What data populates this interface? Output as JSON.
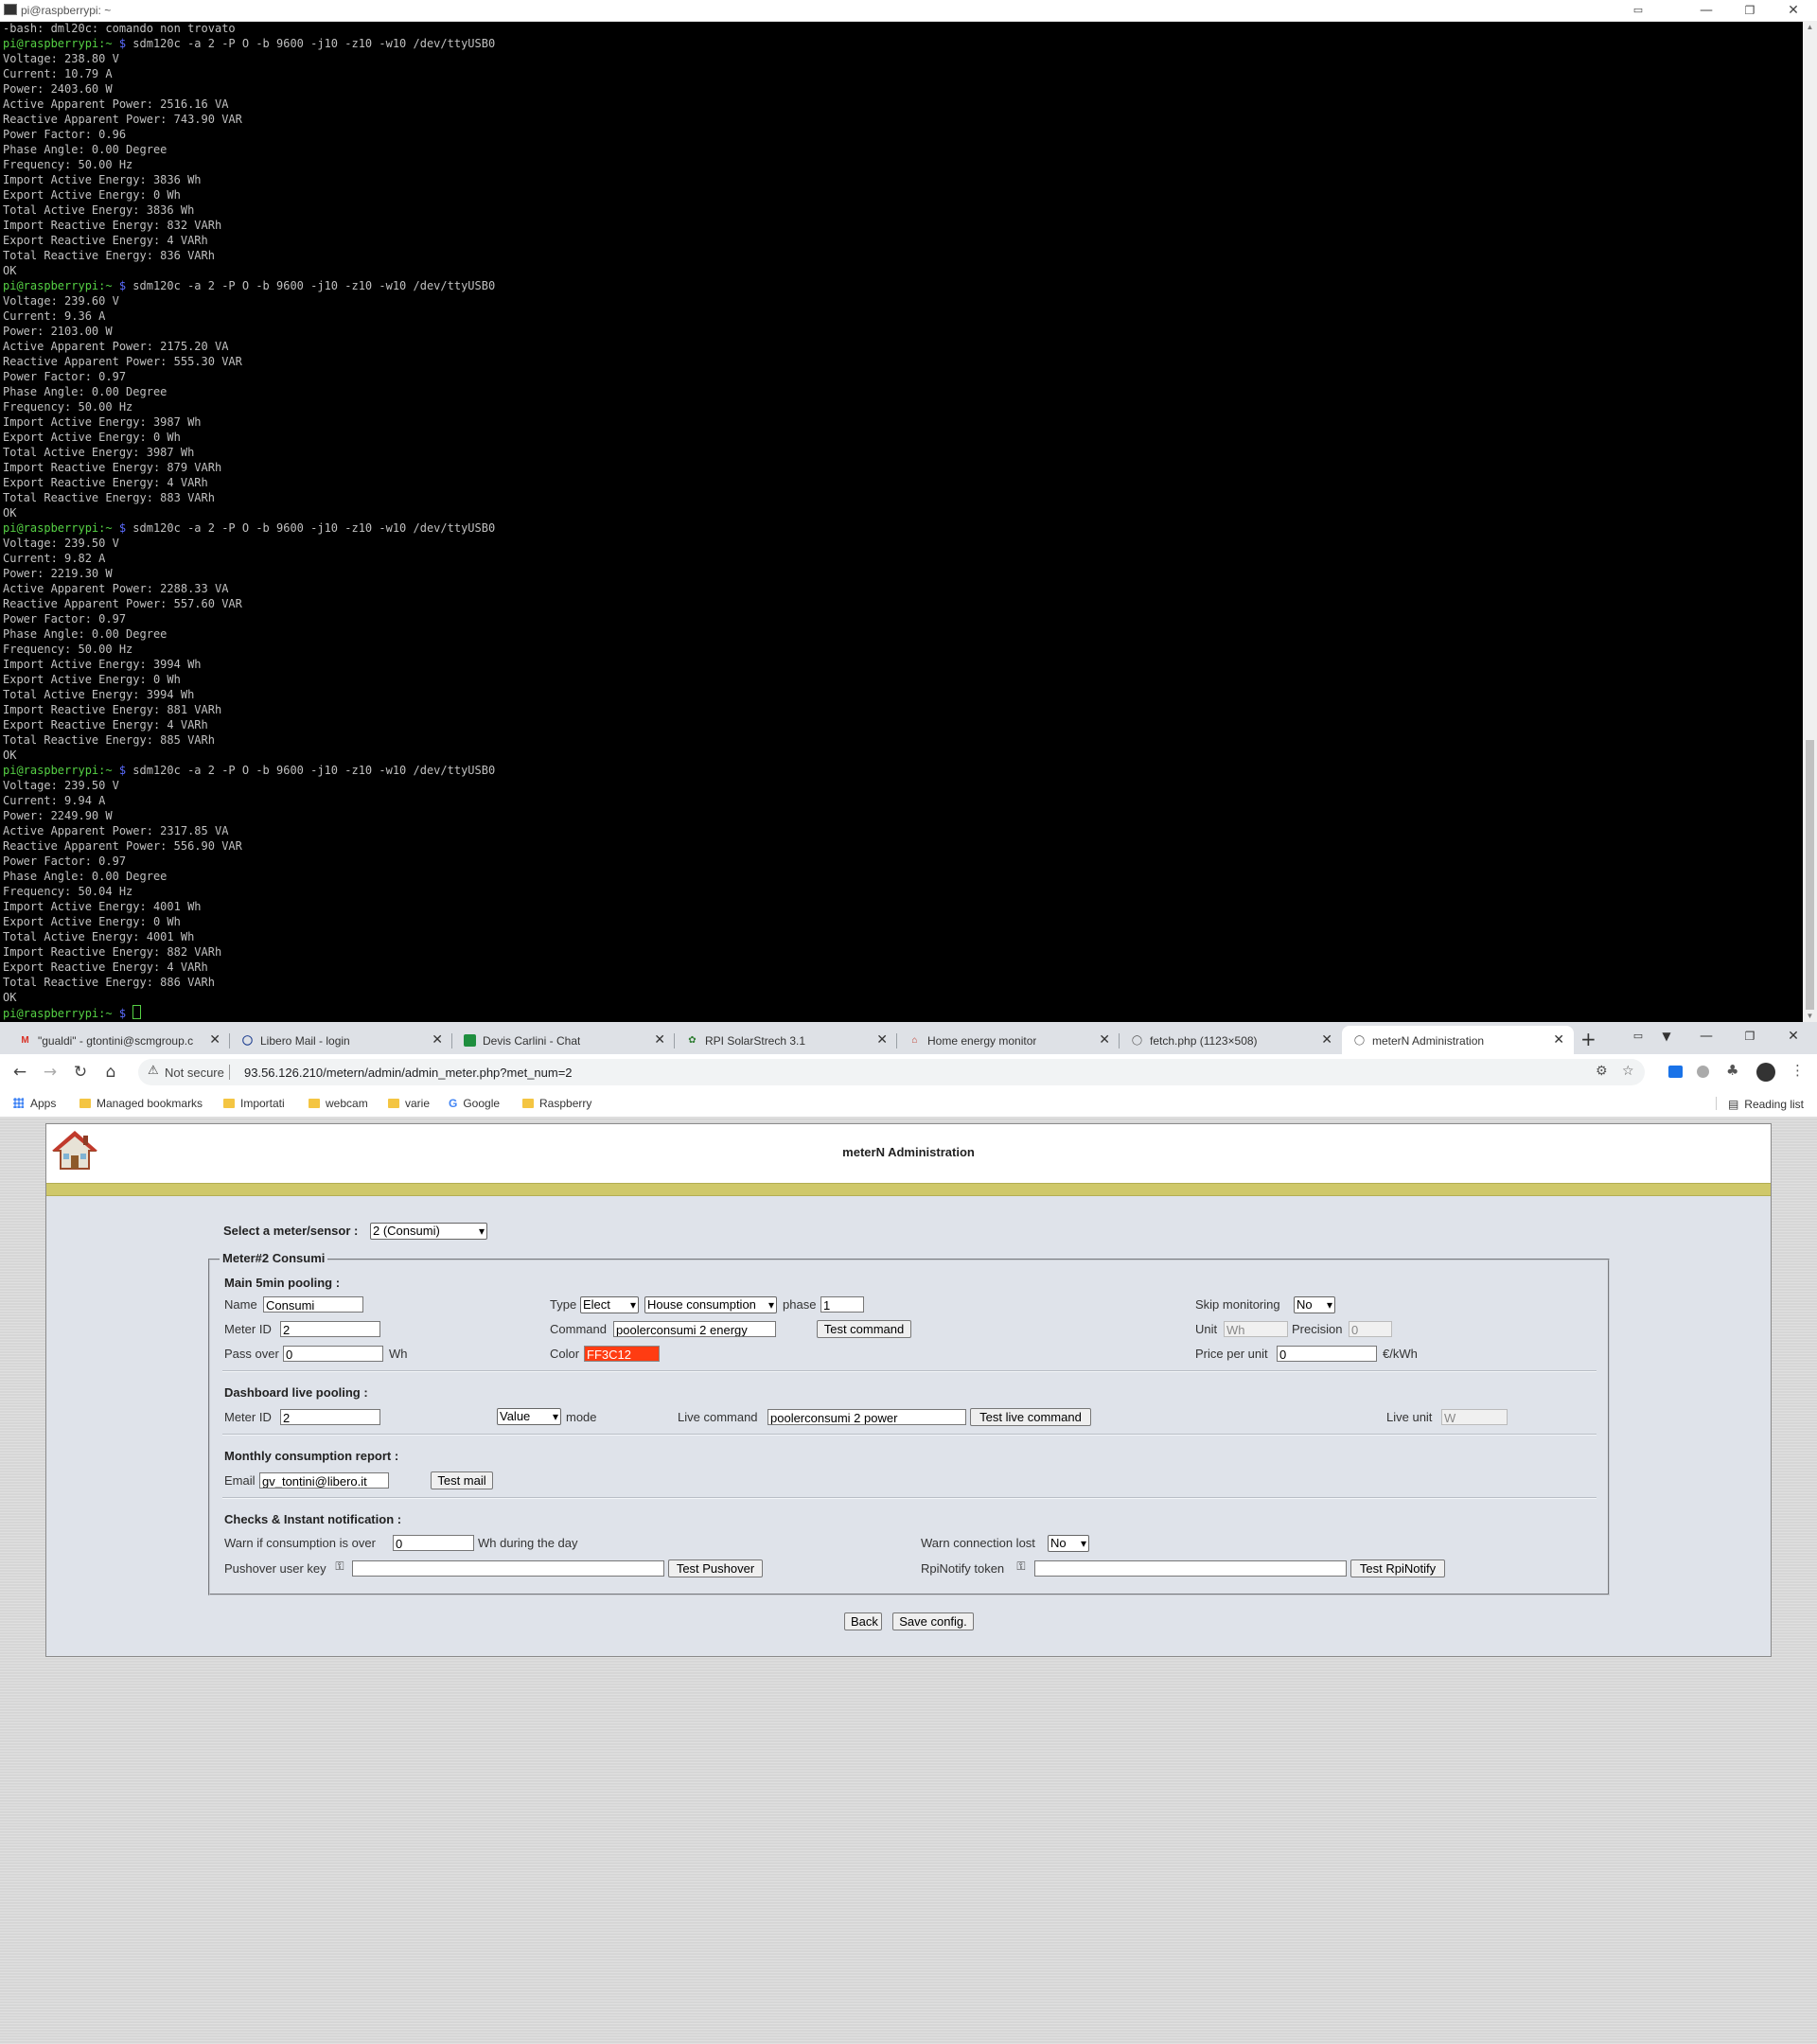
{
  "terminal": {
    "title": "pi@raspberrypi: ~",
    "prompt_user": "pi@raspberrypi:",
    "prompt_path": "~",
    "prompt_symbol": "$",
    "command": "sdm120c -a 2 -P O -b 9600 -j10 -z10 -w10 /dev/ttyUSB0",
    "first_line": "-bash: dml20c: comando non trovato",
    "readings": [
      [
        "Voltage: 238.80 V",
        "Current: 10.79 A",
        "Power: 2403.60 W",
        "Active Apparent Power: 2516.16 VA",
        "Reactive Apparent Power: 743.90 VAR",
        "Power Factor: 0.96",
        "Phase Angle: 0.00 Degree",
        "Frequency: 50.00 Hz",
        "Import Active Energy: 3836 Wh",
        "Export Active Energy: 0 Wh",
        "Total Active Energy: 3836 Wh",
        "Import Reactive Energy: 832 VARh",
        "Export Reactive Energy: 4 VARh",
        "Total Reactive Energy: 836 VARh",
        "OK"
      ],
      [
        "Voltage: 239.60 V",
        "Current: 9.36 A",
        "Power: 2103.00 W",
        "Active Apparent Power: 2175.20 VA",
        "Reactive Apparent Power: 555.30 VAR",
        "Power Factor: 0.97",
        "Phase Angle: 0.00 Degree",
        "Frequency: 50.00 Hz",
        "Import Active Energy: 3987 Wh",
        "Export Active Energy: 0 Wh",
        "Total Active Energy: 3987 Wh",
        "Import Reactive Energy: 879 VARh",
        "Export Reactive Energy: 4 VARh",
        "Total Reactive Energy: 883 VARh",
        "OK"
      ],
      [
        "Voltage: 239.50 V",
        "Current: 9.82 A",
        "Power: 2219.30 W",
        "Active Apparent Power: 2288.33 VA",
        "Reactive Apparent Power: 557.60 VAR",
        "Power Factor: 0.97",
        "Phase Angle: 0.00 Degree",
        "Frequency: 50.00 Hz",
        "Import Active Energy: 3994 Wh",
        "Export Active Energy: 0 Wh",
        "Total Active Energy: 3994 Wh",
        "Import Reactive Energy: 881 VARh",
        "Export Reactive Energy: 4 VARh",
        "Total Reactive Energy: 885 VARh",
        "OK"
      ],
      [
        "Voltage: 239.50 V",
        "Current: 9.94 A",
        "Power: 2249.90 W",
        "Active Apparent Power: 2317.85 VA",
        "Reactive Apparent Power: 556.90 VAR",
        "Power Factor: 0.97",
        "Phase Angle: 0.00 Degree",
        "Frequency: 50.04 Hz",
        "Import Active Energy: 4001 Wh",
        "Export Active Energy: 0 Wh",
        "Total Active Energy: 4001 Wh",
        "Import Reactive Energy: 882 VARh",
        "Export Reactive Energy: 4 VARh",
        "Total Reactive Energy: 886 VARh",
        "OK"
      ]
    ]
  },
  "browser": {
    "tabs": [
      {
        "label": "\"gualdi\" - gtontini@scmgroup.c",
        "icon": "gmail-icon",
        "active": false
      },
      {
        "label": "Libero Mail - login",
        "icon": "libero-icon",
        "active": false
      },
      {
        "label": "Devis Carlini - Chat",
        "icon": "chat-icon",
        "active": false
      },
      {
        "label": "RPI SolarStrech 3.1",
        "icon": "solar-icon",
        "active": false
      },
      {
        "label": "Home energy monitor",
        "icon": "home-icon",
        "active": false
      },
      {
        "label": "fetch.php (1123×508)",
        "icon": "globe-icon",
        "active": false
      },
      {
        "label": "meterN Administration",
        "icon": "globe-icon",
        "active": true
      }
    ],
    "security_label": "Not secure",
    "url": "93.56.126.210/metern/admin/admin_meter.php?met_num=2",
    "bookmarks": [
      "Apps",
      "Managed bookmarks",
      "Importati",
      "webcam",
      "varie",
      "Google",
      "Raspberry"
    ],
    "reading_list": "Reading list"
  },
  "admin": {
    "title": "meterN Administration",
    "select_meter_label": "Select a meter/sensor :",
    "select_meter_value": "2 (Consumi)",
    "legend": "Meter#2 Consumi",
    "main": {
      "heading": "Main 5min pooling :",
      "name_label": "Name",
      "name_value": "Consumi",
      "type_label": "Type",
      "type_value": "Elect",
      "type2_value": "House consumption",
      "phase_label": "phase",
      "phase_value": "1",
      "skip_label": "Skip monitoring",
      "skip_value": "No",
      "meterid_label": "Meter ID",
      "meterid_value": "2",
      "command_label": "Command",
      "command_value": "poolerconsumi 2 energy",
      "test_command": "Test command",
      "unit_label": "Unit",
      "unit_value": "Wh",
      "precision_label": "Precision",
      "precision_value": "0",
      "passover_label": "Pass over",
      "passover_value": "0",
      "passover_unit": "Wh",
      "color_label": "Color",
      "color_value": "FF3C12",
      "price_label": "Price per unit",
      "price_value": "0",
      "price_unit": "€/kWh"
    },
    "live": {
      "heading": "Dashboard live pooling :",
      "meterid_label": "Meter ID",
      "meterid_value": "2",
      "mode_value": "Value",
      "mode_label": "mode",
      "command_label": "Live command",
      "command_value": "poolerconsumi 2 power",
      "test_button": "Test live command",
      "unit_label": "Live unit",
      "unit_value": "W"
    },
    "report": {
      "heading": "Monthly consumption report :",
      "email_label": "Email",
      "email_value": "gv_tontini@libero.it",
      "test_button": "Test mail"
    },
    "checks": {
      "heading": "Checks & Instant notification :",
      "warn_label": "Warn if consumption is over",
      "warn_value": "0",
      "warn_suffix": "Wh during the day",
      "conn_label": "Warn connection lost",
      "conn_value": "No",
      "pushover_label": "Pushover user key",
      "pushover_value": "",
      "pushover_button": "Test Pushover",
      "rpi_label": "RpiNotify token",
      "rpi_value": "",
      "rpi_button": "Test RpiNotify"
    },
    "back_button": "Back",
    "save_button": "Save config.",
    "colors": {
      "band": "#cfc86a",
      "panel": "#dfe3ea",
      "swatch": "#ff3c12"
    }
  }
}
